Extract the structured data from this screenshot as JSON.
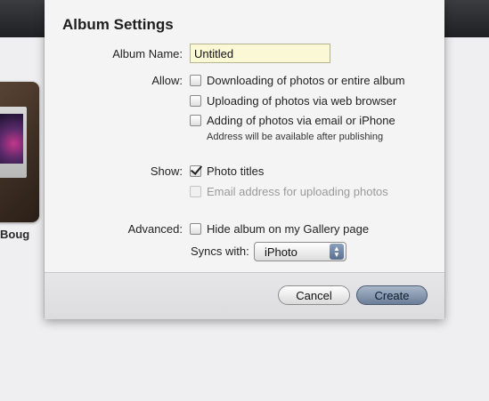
{
  "background": {
    "thumbnail_label": "Boug"
  },
  "dialog": {
    "title": "Album Settings",
    "album_name": {
      "label": "Album Name:",
      "value": "Untitled"
    },
    "allow": {
      "label": "Allow:",
      "options": [
        {
          "label": "Downloading of photos or entire album",
          "checked": false,
          "enabled": true
        },
        {
          "label": "Uploading of photos via web browser",
          "checked": false,
          "enabled": true
        },
        {
          "label": "Adding of photos via email or iPhone",
          "checked": false,
          "enabled": true
        }
      ],
      "note": "Address will be available after publishing"
    },
    "show": {
      "label": "Show:",
      "options": [
        {
          "label": "Photo titles",
          "checked": true,
          "enabled": true
        },
        {
          "label": "Email address for uploading photos",
          "checked": false,
          "enabled": false
        }
      ]
    },
    "advanced": {
      "label": "Advanced:",
      "hide_option": {
        "label": "Hide album on my Gallery page",
        "checked": false,
        "enabled": true
      },
      "syncs_label": "Syncs with:",
      "syncs_value": "iPhoto"
    },
    "buttons": {
      "cancel": "Cancel",
      "create": "Create"
    }
  },
  "colors": {
    "input_bg": "#fbf8d6",
    "primary_button": "#7f91ab",
    "topbar": "#2a2b2e"
  }
}
